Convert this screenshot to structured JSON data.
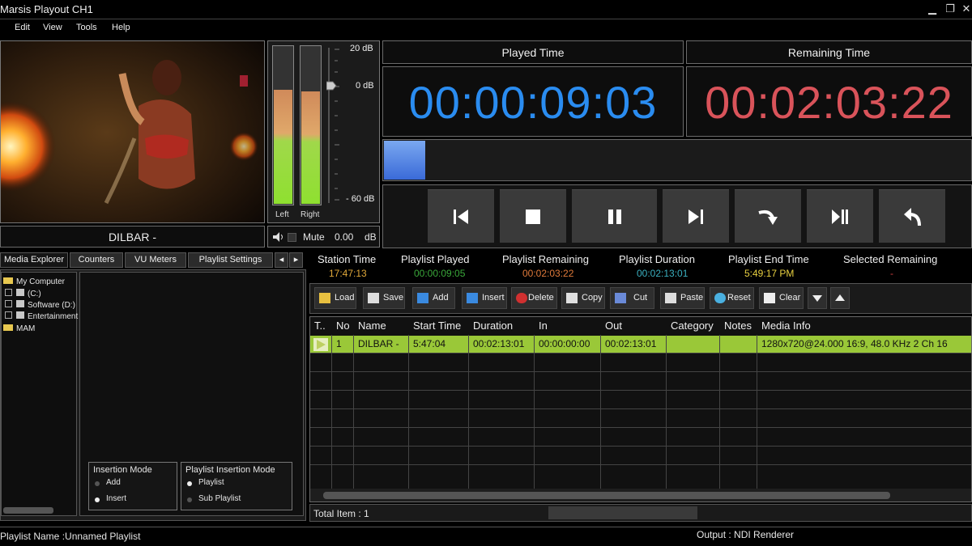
{
  "window": {
    "title": "Marsis Playout CH1",
    "minimize": "▁",
    "restore": "❐",
    "close": "✕"
  },
  "menu": [
    "Edit",
    "View",
    "Tools",
    "Help"
  ],
  "preview": {
    "clip_name": "DILBAR -"
  },
  "audio": {
    "db_top": "20 dB",
    "db_mid": "0 dB",
    "db_bottom": "- 60 dB",
    "left_label": "Left",
    "right_label": "Right",
    "left_level": 0.72,
    "right_level": 0.71,
    "mute_label": "Mute",
    "volume_value": "0.00",
    "volume_unit": "dB"
  },
  "played_time": {
    "label": "Played Time",
    "value": "00:00:09:03",
    "color": "#2a8cf0"
  },
  "remaining_time": {
    "label": "Remaining Time",
    "value": "00:02:03:22",
    "color": "#d9535a"
  },
  "progress": {
    "fraction": 0.07
  },
  "tabs": [
    "Media Explorer",
    "Counters",
    "VU Meters",
    "Playlist Settings"
  ],
  "tab_scroll": {
    "left": "◂",
    "right": "▸"
  },
  "explorer": {
    "items": [
      "My Computer",
      "(C:)",
      "Software (D:)",
      "Entertainment",
      "MAM"
    ]
  },
  "insertion_mode": {
    "title": "Insertion Mode",
    "options": [
      "Add",
      "Insert"
    ],
    "selected": "Insert"
  },
  "playlist_insertion_mode": {
    "title": "Playlist Insertion Mode",
    "options": [
      "Playlist",
      "Sub Playlist"
    ],
    "selected": "Playlist"
  },
  "stats": [
    {
      "label": "Station Time",
      "value": "17:47:13",
      "color": "#e0a83a"
    },
    {
      "label": "Playlist Played",
      "value": "00:00:09:05",
      "color": "#3aa83a"
    },
    {
      "label": "Playlist Remaining",
      "value": "00:02:03:22",
      "color": "#e07a3a"
    },
    {
      "label": "Playlist Duration",
      "value": "00:02:13:01",
      "color": "#3ab0c0"
    },
    {
      "label": "Playlist End Time",
      "value": "5:49:17 PM",
      "color": "#e8d040"
    },
    {
      "label": "Selected Remaining",
      "value": "-",
      "color": "#d04040"
    }
  ],
  "toolbar": [
    "Load",
    "Save",
    "Add",
    "Insert",
    "Delete",
    "Copy",
    "Cut",
    "Paste",
    "Reset",
    "Clear"
  ],
  "table": {
    "columns": [
      "T..",
      "No",
      "Name",
      "Start Time",
      "Duration",
      "In",
      "Out",
      "Category",
      "Notes",
      "Media Info"
    ],
    "rows": [
      {
        "no": "1",
        "name": "DILBAR -",
        "start": "5:47:04",
        "duration": "00:02:13:01",
        "in": "00:00:00:00",
        "out": "00:02:13:01",
        "category": "",
        "notes": "",
        "media_info": "1280x720@24.000  16:9, 48.0 KHz 2 Ch 16"
      }
    ]
  },
  "total_items": "Total Item : 1",
  "status": {
    "playlist_name": "Playlist Name :Unnamed Playlist",
    "output": "Output : NDI Renderer"
  }
}
